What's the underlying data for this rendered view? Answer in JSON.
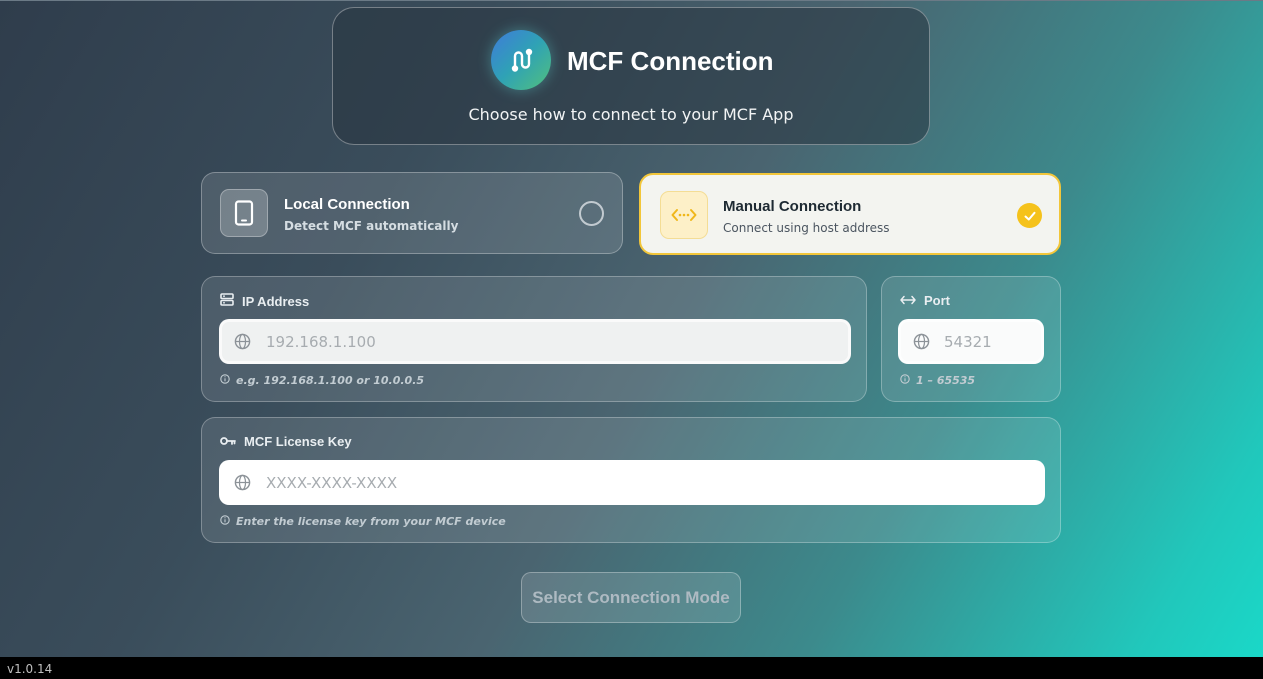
{
  "header": {
    "title": "MCF Connection",
    "subtitle": "Choose how to connect to your MCF App",
    "logo_icon": "route-icon"
  },
  "options": {
    "local": {
      "title": "Local Connection",
      "description": "Detect MCF automatically",
      "icon": "tablet-icon",
      "selected": false
    },
    "manual": {
      "title": "Manual Connection",
      "description": "Connect using host address",
      "icon": "arrows-horizontal-icon",
      "selected": true
    }
  },
  "ip": {
    "label": "IP Address",
    "placeholder": "192.168.1.100",
    "value": "",
    "hint": "e.g. 192.168.1.100 or 10.0.0.5"
  },
  "port": {
    "label": "Port",
    "placeholder": "54321",
    "value": "",
    "hint": "1 – 65535"
  },
  "license": {
    "label": "MCF License Key",
    "placeholder": "XXXX-XXXX-XXXX",
    "value": "",
    "hint": "Enter the license key from your MCF device"
  },
  "submit_label": "Select Connection Mode",
  "version": "v1.0.14",
  "colors": {
    "accent": "#f5c21b",
    "selected_card_bg": "#f3f4f0",
    "gradient_start": "#2f3d4c",
    "gradient_end": "#1ad8c8"
  }
}
